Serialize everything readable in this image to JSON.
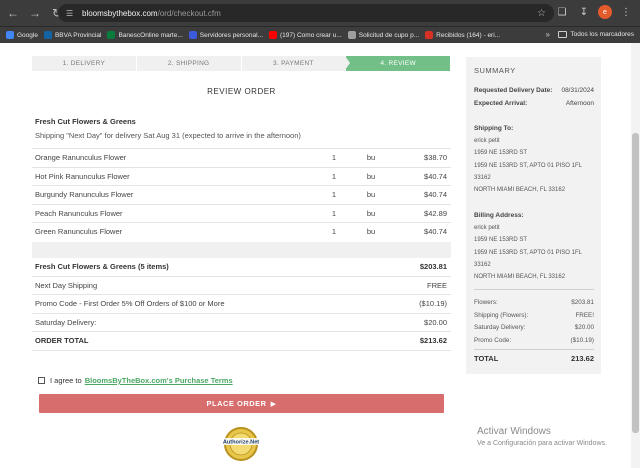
{
  "browser": {
    "url_host": "bloomsbythebox.com",
    "url_path": "/ord/checkout.cfm",
    "bookmarks": [
      {
        "label": "Google",
        "color": "#4285f4"
      },
      {
        "label": "BBVA Provincial",
        "color": "#1464a5"
      },
      {
        "label": "BanescOnline marte...",
        "color": "#0a7c3e"
      },
      {
        "label": "Servidores personal...",
        "color": "#3b5bdb"
      },
      {
        "label": "(197) Como crear u...",
        "color": "#ff0000"
      },
      {
        "label": "Solicitud de cupo p...",
        "color": "#9e9e9e"
      },
      {
        "label": "Recibidos (164) - eri...",
        "color": "#d93025"
      }
    ],
    "bookmarks_more": "»",
    "all_bookmarks": "Todos los marcadores",
    "avatar_letter": "e"
  },
  "steps": [
    {
      "label": "1. DELIVERY"
    },
    {
      "label": "2. SHIPPING"
    },
    {
      "label": "3. PAYMENT"
    },
    {
      "label": "4. REVIEW"
    }
  ],
  "review": {
    "title": "REVIEW ORDER",
    "section": "Fresh Cut Flowers & Greens",
    "shipping_note": "Shipping \"Next Day\" for delivery Sat Aug 31 (expected to arrive in the afternoon)",
    "items": [
      {
        "name": "Orange Ranunculus Flower",
        "qty": "1",
        "unit": "bu",
        "price": "$38.70"
      },
      {
        "name": "Hot Pink Ranunculus Flower",
        "qty": "1",
        "unit": "bu",
        "price": "$40.74"
      },
      {
        "name": "Burgundy Ranunculus Flower",
        "qty": "1",
        "unit": "bu",
        "price": "$40.74"
      },
      {
        "name": "Peach Ranunculus Flower",
        "qty": "1",
        "unit": "bu",
        "price": "$42.89"
      },
      {
        "name": "Green Ranunculus Flower",
        "qty": "1",
        "unit": "bu",
        "price": "$40.74"
      }
    ],
    "totals": [
      {
        "label": "Fresh Cut Flowers & Greens (5 items)",
        "value": "$203.81",
        "bold": true
      },
      {
        "label": "Next Day Shipping",
        "value": "FREE",
        "bold": false
      },
      {
        "label": "Promo Code - First Order 5% Off Orders of $100 or More",
        "value": "($10.19)",
        "bold": false
      },
      {
        "label": "Saturday Delivery:",
        "value": "$20.00",
        "bold": false
      },
      {
        "label": "ORDER TOTAL",
        "value": "$213.62",
        "bold": true
      }
    ],
    "agree_text": "I agree to",
    "terms_link": "BloomsByTheBox.com's Purchase Terms",
    "place_order": "PLACE ORDER",
    "seal_text": "Authorize.Net"
  },
  "summary": {
    "title": "SUMMARY",
    "requested_label": "Requested Delivery Date:",
    "requested_value": "08/31/2024",
    "expected_label": "Expected Arrival:",
    "expected_value": "Afternoon",
    "ship_to_label": "Shipping To:",
    "ship_to_lines": [
      "erick petit",
      "1959 NE 153RD ST",
      "1959 NE 153RD ST, APTO 01 PISO 1FL",
      "33162",
      "NORTH MIAMI BEACH, FL 33162"
    ],
    "bill_label": "Billing Address:",
    "bill_lines": [
      "erick petit",
      "1959 NE 153RD ST",
      "1959 NE 153RD ST, APTO 01 PISO 1FL",
      "33162",
      "NORTH MIAMI BEACH, FL 33162"
    ],
    "costs": [
      {
        "label": "Flowers:",
        "value": "$203.81"
      },
      {
        "label": "Shipping (Flowers):",
        "value": "FREE!"
      },
      {
        "label": "Saturday Delivery:",
        "value": "$20.00"
      },
      {
        "label": "Promo Code:",
        "value": "($10.19)"
      }
    ],
    "total_label": "TOTAL",
    "total_value": "213.62"
  },
  "watermark": {
    "line1": "Activar Windows",
    "line2": "Ve a Configuración para activar Windows."
  }
}
